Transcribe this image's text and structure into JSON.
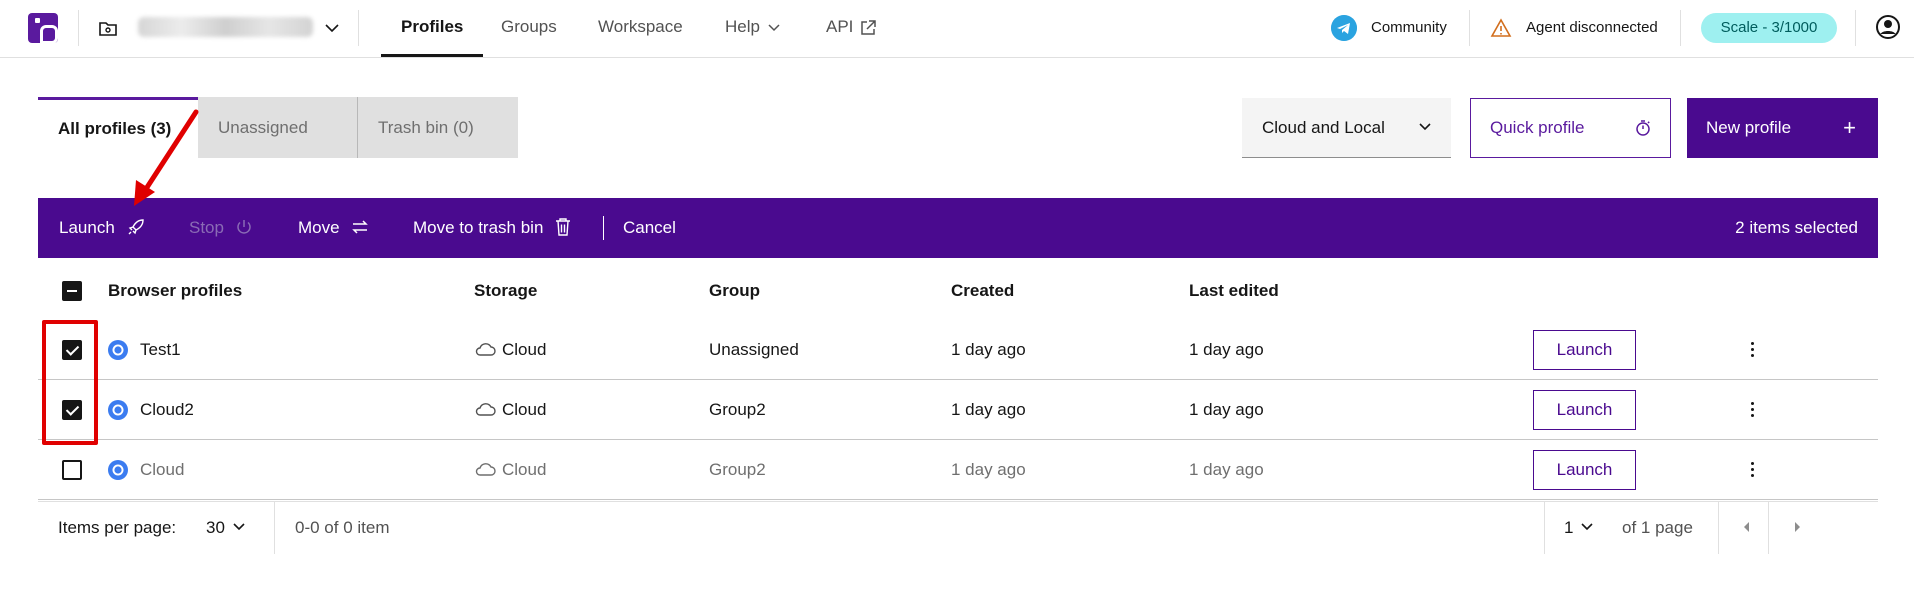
{
  "header": {
    "nav": [
      "Profiles",
      "Groups",
      "Workspace",
      "Help",
      "API"
    ],
    "community": "Community",
    "agent_status": "Agent disconnected",
    "scale": "Scale - 3/1000"
  },
  "tabs": [
    "All profiles (3)",
    "Unassigned",
    "Trash bin (0)"
  ],
  "actions": {
    "filter": "Cloud and Local",
    "quick_profile": "Quick profile",
    "new_profile": "New profile"
  },
  "action_bar": {
    "launch": "Launch",
    "stop": "Stop",
    "move": "Move",
    "trash": "Move to trash bin",
    "cancel": "Cancel",
    "selected": "2 items selected"
  },
  "table": {
    "columns": [
      "Browser profiles",
      "Storage",
      "Group",
      "Created",
      "Last edited"
    ],
    "rows": [
      {
        "name": "Test1",
        "storage": "Cloud",
        "group": "Unassigned",
        "created": "1 day ago",
        "edited": "1 day ago",
        "checked": true,
        "action": "Launch"
      },
      {
        "name": "Cloud2",
        "storage": "Cloud",
        "group": "Group2",
        "created": "1 day ago",
        "edited": "1 day ago",
        "checked": true,
        "action": "Launch"
      },
      {
        "name": "Cloud",
        "storage": "Cloud",
        "group": "Group2",
        "created": "1 day ago",
        "edited": "1 day ago",
        "checked": false,
        "action": "Launch"
      }
    ]
  },
  "pagination": {
    "label": "Items per page:",
    "per_page": "30",
    "range": "0-0 of 0 item",
    "page": "1",
    "of_pages": "of 1 page"
  },
  "colors": {
    "brand": "#4a0a8f",
    "annotation": "#e00000",
    "scale_badge": "#9ef0f0"
  }
}
